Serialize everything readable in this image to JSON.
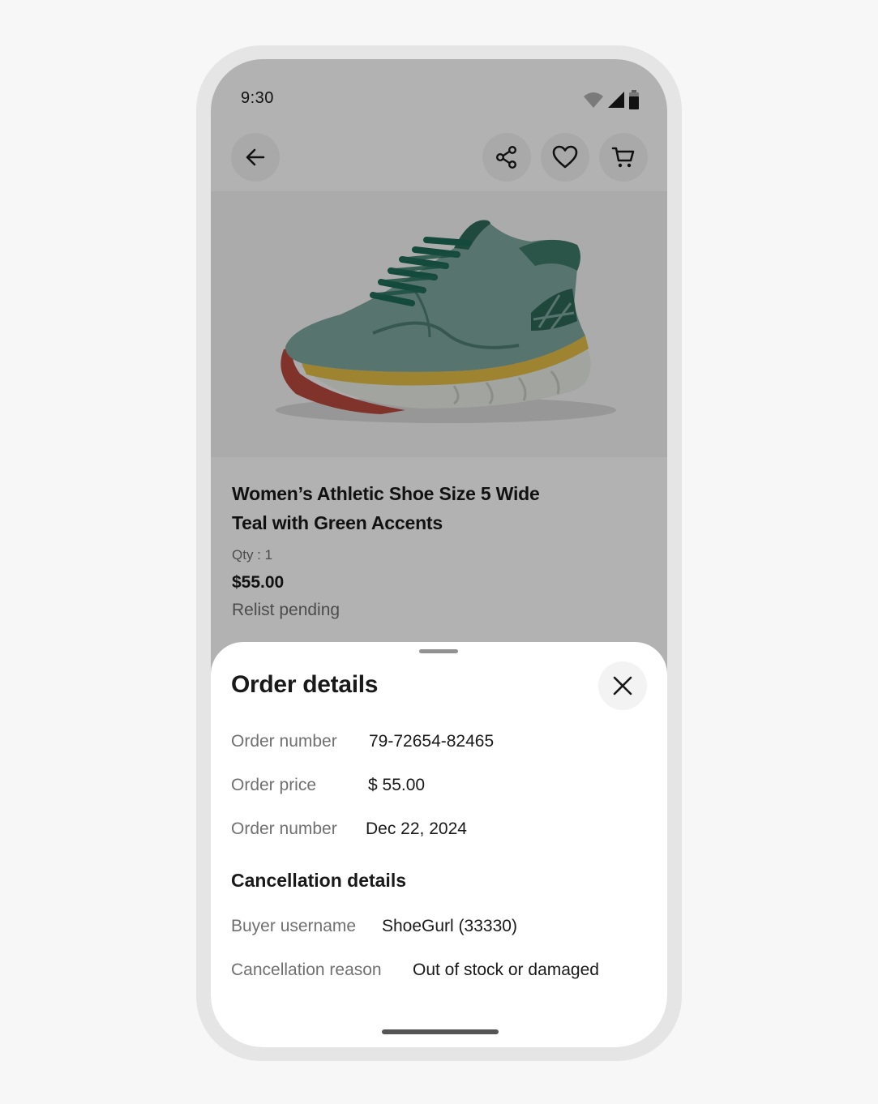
{
  "status_bar": {
    "time": "9:30"
  },
  "nav": {
    "back_icon": "arrow-left-icon",
    "share_icon": "share-icon",
    "watch_icon": "heart-icon",
    "cart_icon": "cart-icon"
  },
  "product": {
    "image": "teal athletic shoe with green laces and yellow midsole",
    "title_line1": "Women’s Athletic Shoe Size 5 Wide",
    "title_line2": "Teal with Green Accents",
    "qty": "Qty : 1",
    "price": "$55.00",
    "status": "Relist pending"
  },
  "sheet": {
    "title": "Order details",
    "close_icon": "close-icon",
    "order_rows": [
      {
        "label": "Order number",
        "value": "79-72654-82465"
      },
      {
        "label": "Order price",
        "value": "$ 55.00"
      },
      {
        "label": "Order number",
        "value": "Dec 22, 2024"
      }
    ],
    "cancellation_title": "Cancellation details",
    "cancellation_rows": [
      {
        "label": "Buyer username",
        "value": "ShoeGurl (33330)"
      },
      {
        "label": "Cancellation reason",
        "value": "Out of stock or damaged"
      }
    ]
  },
  "colors": {
    "scrim": "#000000",
    "text_primary": "#191919",
    "text_secondary": "#707070",
    "button_bg": "#f3f3f3",
    "shoe_teal": "#7fa6a0",
    "shoe_midsole": "#e5c04a",
    "shoe_laces": "#1e6b55"
  }
}
